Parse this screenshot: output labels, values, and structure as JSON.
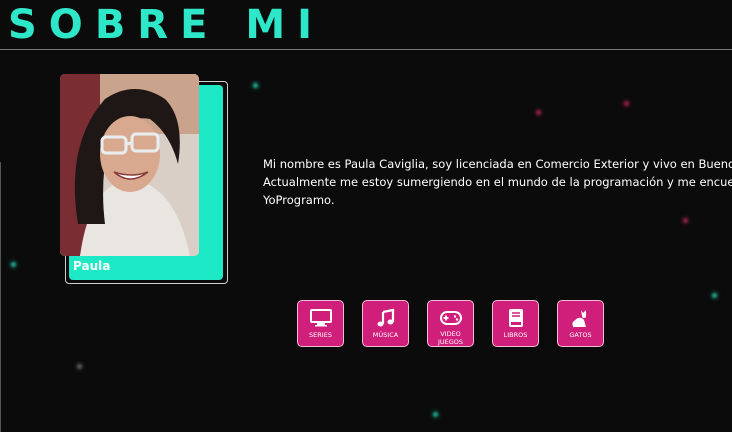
{
  "header": {
    "title": "SOBRE MI"
  },
  "profile": {
    "caption": "Paula"
  },
  "bio": {
    "lines": [
      "Mi nombre es Paula Caviglia, soy licenciada en Comercio Exterior y vivo en Buenos Aires, Argentina.",
      "Actualmente me estoy sumergiendo en el mundo de la programación y me encuentro cursando en",
      "YoProgramo."
    ]
  },
  "hobbies": [
    {
      "label": "SERIES",
      "icon": "tv-icon"
    },
    {
      "label": "MÚSICA",
      "icon": "music-note-icon"
    },
    {
      "label": "VIDEO\nJUEGOS",
      "icon": "gamepad-icon"
    },
    {
      "label": "LIBROS",
      "icon": "book-icon"
    },
    {
      "label": "GATOS",
      "icon": "cat-icon"
    }
  ],
  "colors": {
    "accent_teal": "#1de9c6",
    "button_pink": "#cf1f7a",
    "background": "#0b0b0b"
  }
}
